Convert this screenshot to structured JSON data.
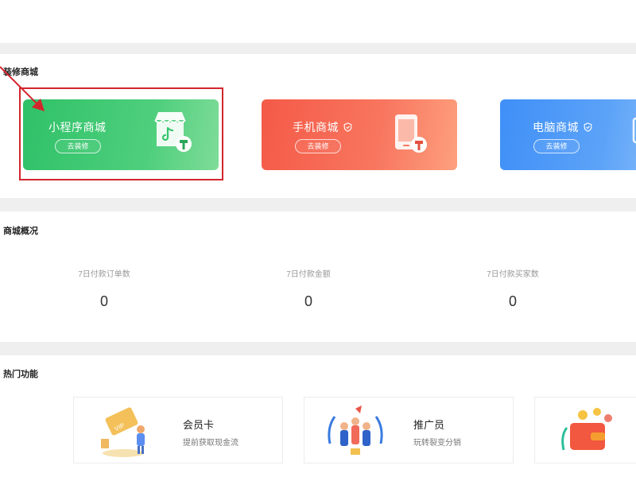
{
  "decor": {
    "title": "装修商城",
    "cards": [
      {
        "title": "小程序商城",
        "button": "去装修",
        "color": "#34c46c"
      },
      {
        "title": "手机商城",
        "button": "去装修",
        "color": "#f65e4a"
      },
      {
        "title": "电脑商城",
        "button": "去装修",
        "color": "#4592f7"
      }
    ]
  },
  "overview": {
    "title": "商城概况",
    "stats": [
      {
        "label": "7日付款订单数",
        "value": "0"
      },
      {
        "label": "7日付款金额",
        "value": "0"
      },
      {
        "label": "7日付款买家数",
        "value": "0"
      }
    ]
  },
  "hot": {
    "title": "热门功能",
    "items": [
      {
        "title": "会员卡",
        "desc": "提前获取现金流"
      },
      {
        "title": "推广员",
        "desc": "玩转裂变分销"
      }
    ]
  },
  "annotation": {
    "highlight_color": "#d2262d"
  }
}
